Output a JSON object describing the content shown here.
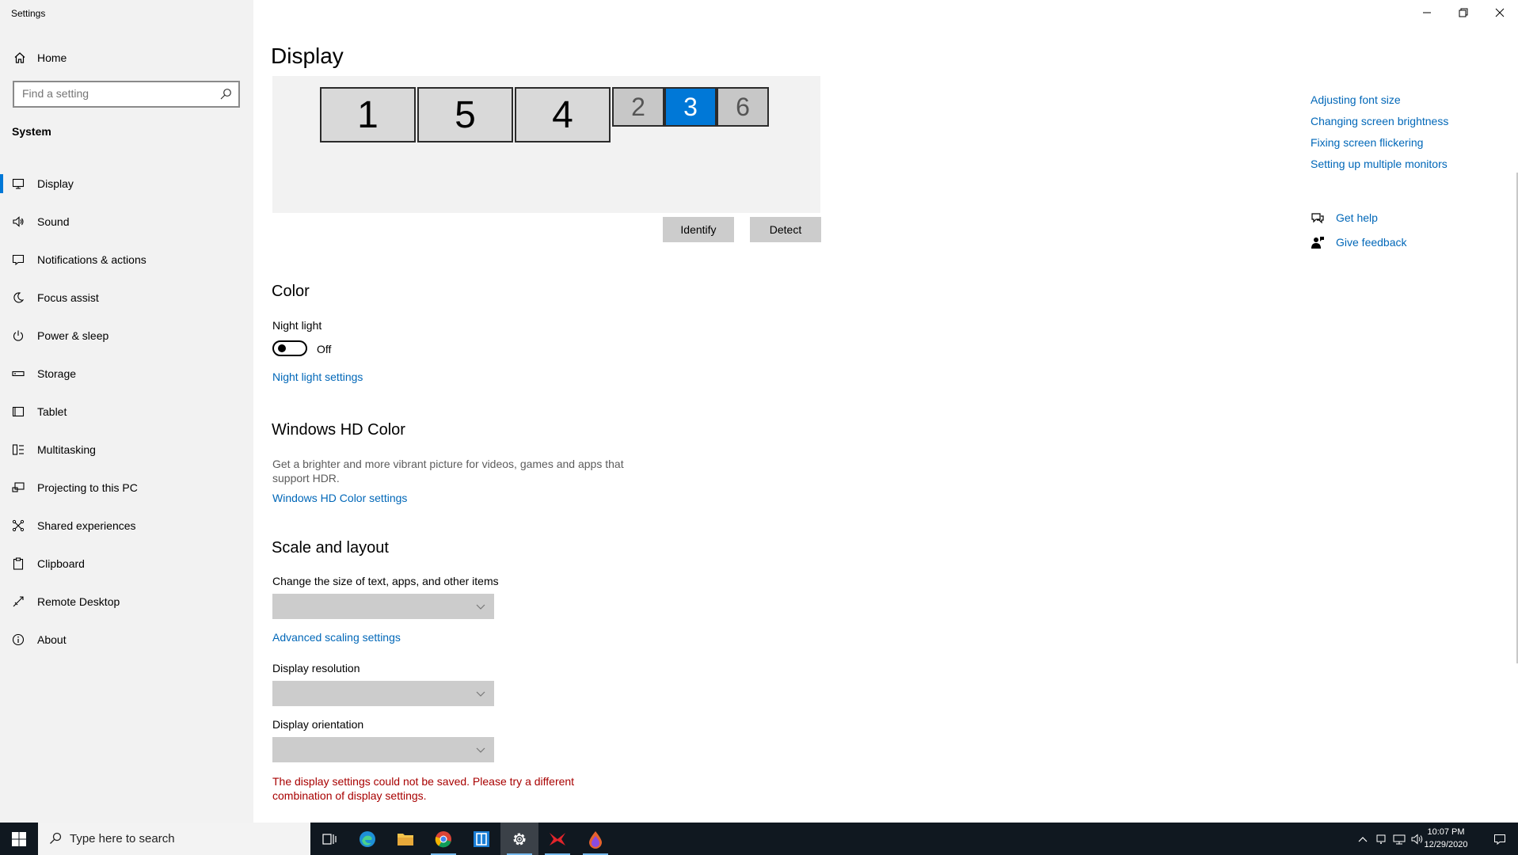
{
  "app": {
    "title": "Settings"
  },
  "sidebar": {
    "home_label": "Home",
    "search_placeholder": "Find a setting",
    "section_label": "System",
    "items": [
      {
        "label": "Display",
        "icon": "monitor-icon",
        "active": true
      },
      {
        "label": "Sound",
        "icon": "speaker-icon"
      },
      {
        "label": "Notifications & actions",
        "icon": "notification-icon"
      },
      {
        "label": "Focus assist",
        "icon": "moon-icon"
      },
      {
        "label": "Power & sleep",
        "icon": "power-icon"
      },
      {
        "label": "Storage",
        "icon": "storage-icon"
      },
      {
        "label": "Tablet",
        "icon": "tablet-icon"
      },
      {
        "label": "Multitasking",
        "icon": "multitasking-icon"
      },
      {
        "label": "Projecting to this PC",
        "icon": "projecting-icon"
      },
      {
        "label": "Shared experiences",
        "icon": "shared-icon"
      },
      {
        "label": "Clipboard",
        "icon": "clipboard-icon"
      },
      {
        "label": "Remote Desktop",
        "icon": "remote-desktop-icon"
      },
      {
        "label": "About",
        "icon": "info-icon"
      }
    ]
  },
  "main": {
    "title": "Display",
    "monitors": [
      "1",
      "5",
      "4",
      "2",
      "3",
      "6"
    ],
    "selected_monitor": "3",
    "identify_label": "Identify",
    "detect_label": "Detect",
    "color": {
      "heading": "Color",
      "night_light_label": "Night light",
      "night_light_state": "Off",
      "night_light_settings": "Night light settings"
    },
    "hdr": {
      "heading": "Windows HD Color",
      "desc_line1": "Get a brighter and more vibrant picture for videos, games and apps that",
      "desc_line2": "support HDR.",
      "link": "Windows HD Color settings"
    },
    "scale": {
      "heading": "Scale and layout",
      "size_label": "Change the size of text, apps, and other items",
      "advanced_link": "Advanced scaling settings",
      "resolution_label": "Display resolution",
      "orientation_label": "Display orientation",
      "error_line1": "The display settings could not be saved. Please try a different",
      "error_line2": "combination of display settings."
    }
  },
  "help": {
    "links": [
      "Adjusting font size",
      "Changing screen brightness",
      "Fixing screen flickering",
      "Setting up multiple monitors"
    ],
    "get_help": "Get help",
    "give_feedback": "Give feedback"
  },
  "taskbar": {
    "search_placeholder": "Type here to search",
    "time": "10:07 PM",
    "date": "12/29/2020"
  },
  "colors": {
    "accent": "#0078d7",
    "link": "#0067b8",
    "error": "#a80000",
    "sidebar_bg": "#f2f2f2",
    "taskbar_bg": "#101820"
  }
}
